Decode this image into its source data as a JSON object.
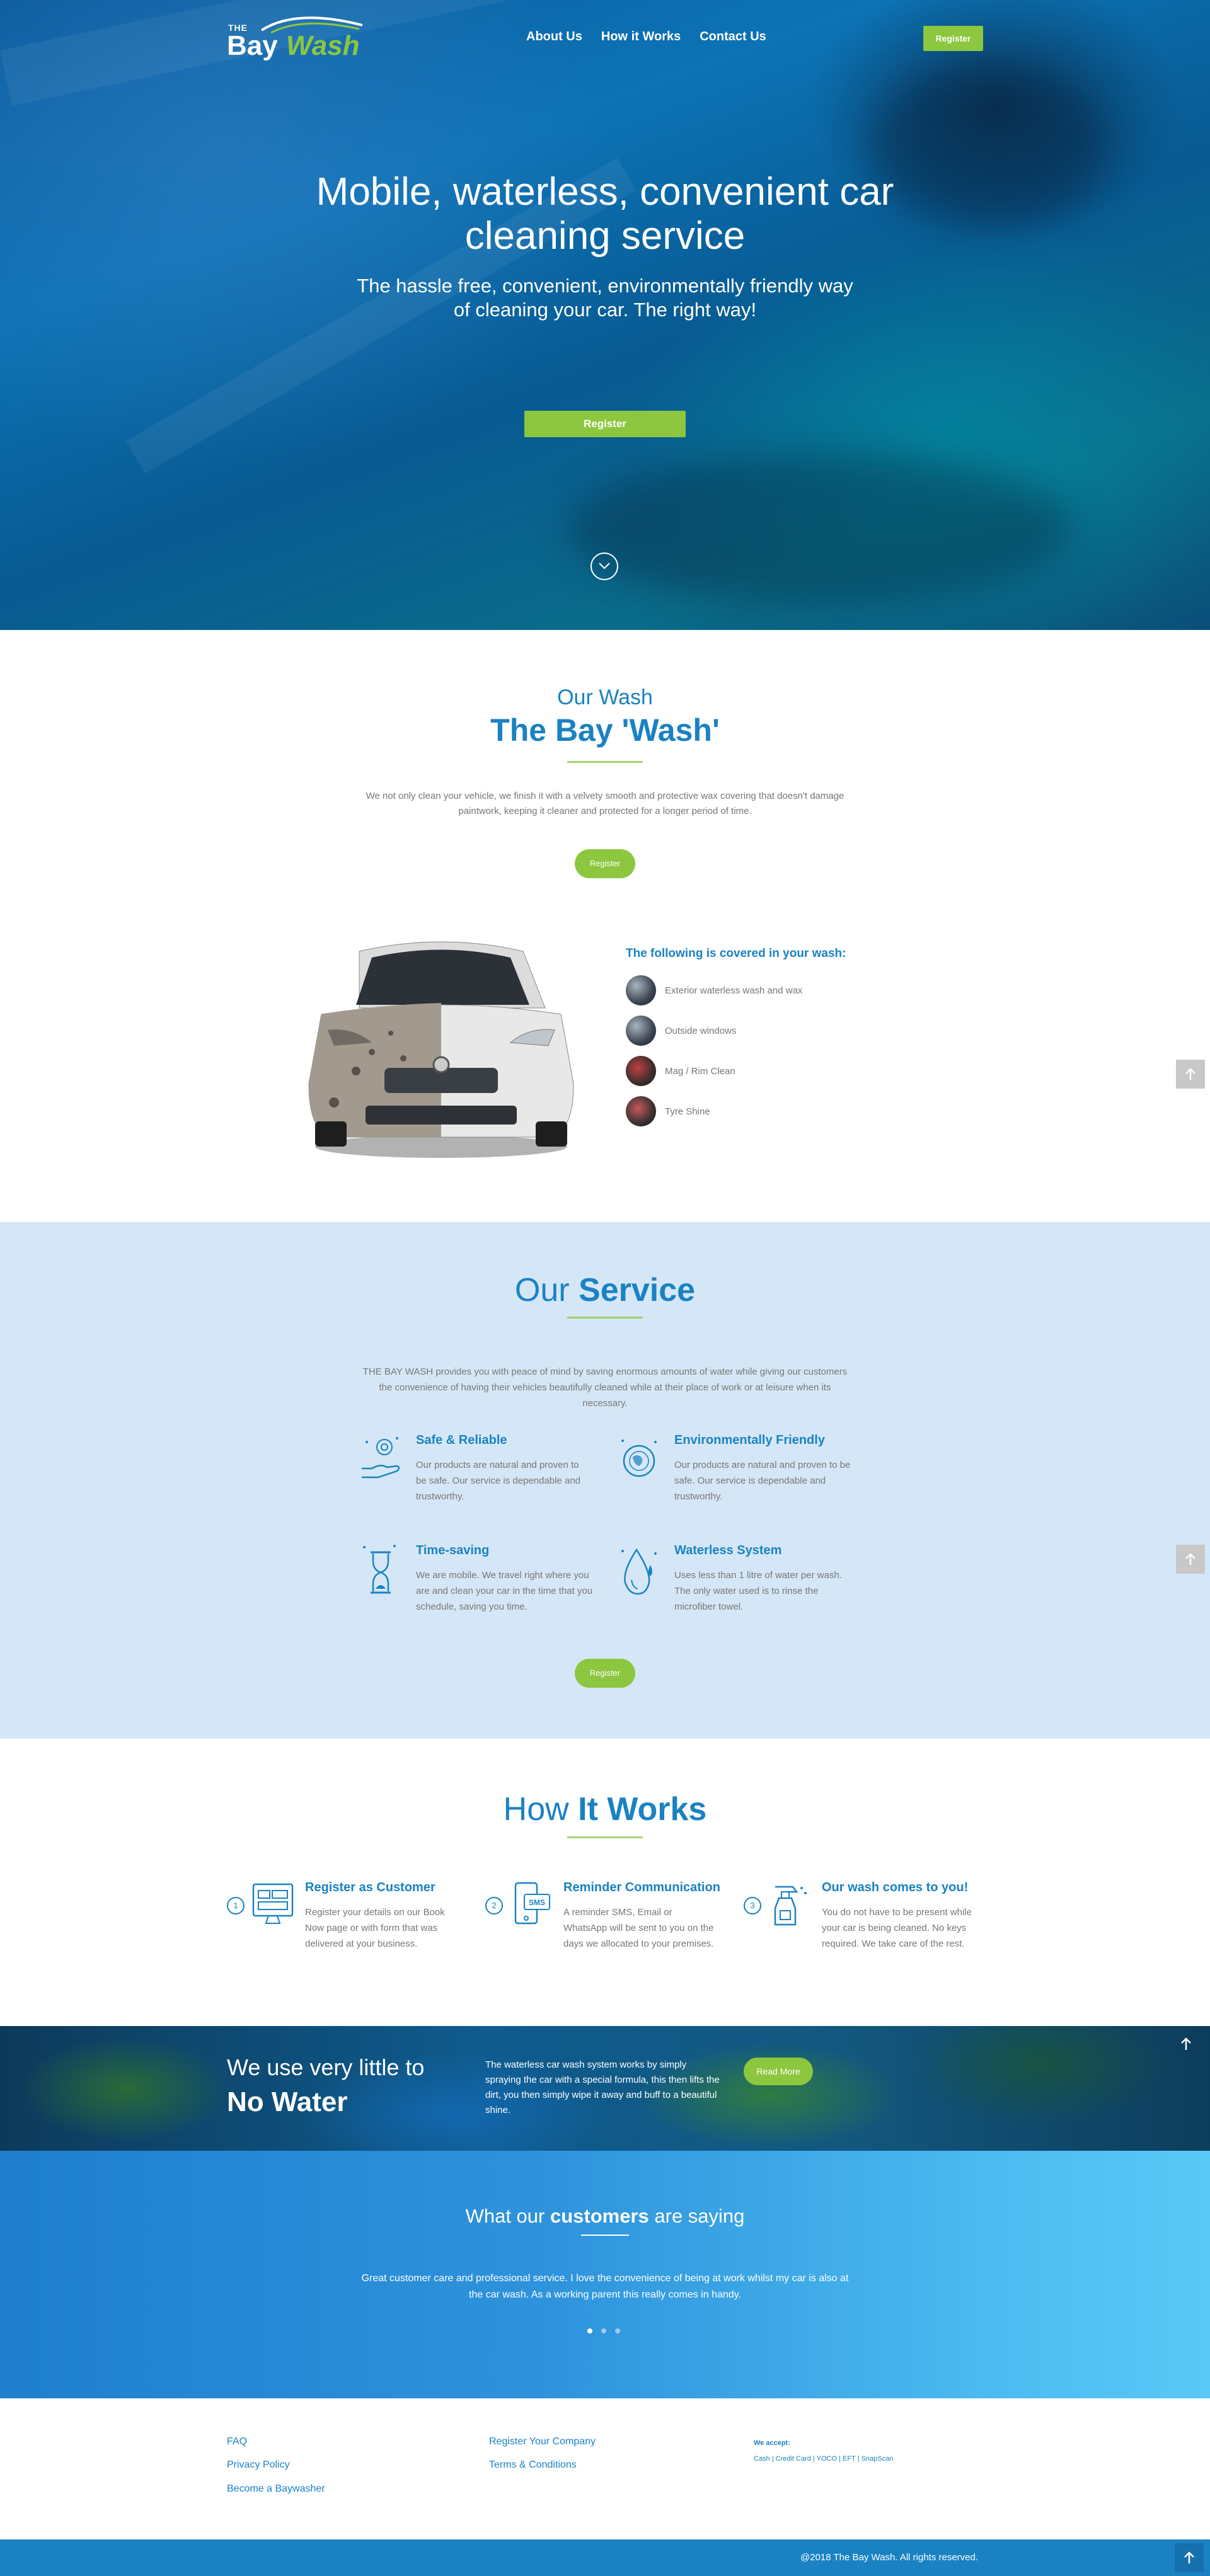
{
  "brand": {
    "logo_the": "THE",
    "logo_bay": "Bay",
    "logo_wash": "Wash"
  },
  "nav": {
    "items": [
      "About Us",
      "How it Works",
      "Contact Us"
    ],
    "register": "Register"
  },
  "hero": {
    "title": "Mobile, waterless, convenient car cleaning service",
    "subtitle": "The hassle free, convenient, environmentally friendly way of cleaning your car. The right way!",
    "register": "Register"
  },
  "wash": {
    "kicker": "Our Wash",
    "title": "The Bay 'Wash'",
    "text": "We not only clean your vehicle, we finish it with a velvety smooth and protective wax covering that doesn't damage paintwork, keeping it cleaner and protected for a longer period of time.",
    "register": "Register",
    "covered_title": "The following is covered in your wash:",
    "covered": [
      "Exterior waterless wash and wax",
      "Outside windows",
      "Mag / Rim Clean",
      "Tyre Shine"
    ]
  },
  "service": {
    "title_light": "Our ",
    "title_bold": "Service",
    "intro": "THE BAY WASH provides you with peace of mind by saving enormous amounts of water while giving our customers the convenience of having their vehicles beautifully cleaned while at their place of work or at leisure when its necessary.",
    "items": [
      {
        "title": "Safe & Reliable",
        "text": "Our products are natural and proven to be safe. Our service is dependable and trustworthy."
      },
      {
        "title": "Environmentally Friendly",
        "text": "Our products are natural and proven to be safe. Our service is dependable and trustworthy."
      },
      {
        "title": "Time-saving",
        "text": "We are mobile. We travel right where you are and clean your car in the time that you schedule, saving you time."
      },
      {
        "title": "Waterless System",
        "text": "Uses less than 1 litre of water per wash. The only water used is to rinse the microfiber towel."
      }
    ],
    "register": "Register"
  },
  "how": {
    "title_light": "How ",
    "title_bold": "It Works",
    "steps": [
      {
        "num": "1",
        "title": "Register as Customer",
        "text": "Register your details on our Book Now page or with form that was delivered at your business."
      },
      {
        "num": "2",
        "title": "Reminder Communication",
        "text": "A reminder SMS, Email or WhatsApp will be sent to you on the days we allocated to your premises."
      },
      {
        "num": "3",
        "title": "Our wash comes to you!",
        "text": "You do not have to be present while your car is being cleaned. No keys required. We take care of the rest."
      }
    ],
    "sms_label": "SMS"
  },
  "nowater": {
    "small": "We use very little to",
    "big": "No Water",
    "text": "The waterless car wash system works by simply spraying the car with a special formula, this then lifts the dirt, you then simply wipe it away and buff to a beautiful shine.",
    "read_more": "Read More"
  },
  "testimonials": {
    "title_a": "What our ",
    "title_b": "customers",
    "title_c": " are saying",
    "quote": "Great customer care and professional service. I love the convenience of being at work whilst my car is also at the car wash. As a working parent this really comes in handy."
  },
  "footer": {
    "col1": [
      "FAQ",
      "Privacy Policy",
      "Become a Baywasher"
    ],
    "col2": [
      "Register Your Company",
      "Terms & Conditions"
    ],
    "accept_title": "We accept:",
    "accept_values": "Cash | Credit Card | YOCO | EFT | SnapScan",
    "copyright": "@2018 The Bay Wash. All rights reserved."
  },
  "colors": {
    "primary": "#1a82c3",
    "accent": "#8dc63f",
    "service_bg": "#d5e7f6"
  },
  "icons": [
    "chevron-down-icon",
    "arrow-up-icon",
    "hand-leaf-icon",
    "globe-icon",
    "hourglass-icon",
    "water-drop-icon",
    "form-icon",
    "phone-sms-icon",
    "spray-bottle-icon"
  ]
}
